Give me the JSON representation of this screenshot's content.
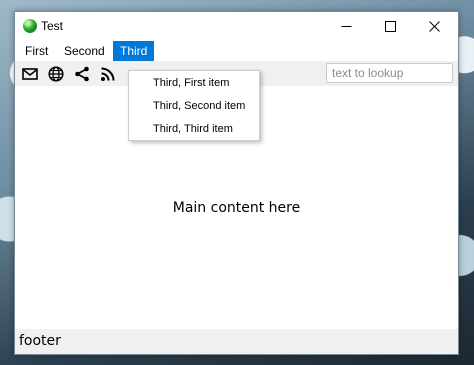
{
  "window": {
    "title": "Test"
  },
  "menubar": {
    "items": [
      {
        "label": "First"
      },
      {
        "label": "Second"
      },
      {
        "label": "Third",
        "state": "open"
      }
    ]
  },
  "dropdown": {
    "items": [
      {
        "label": "Third, First item"
      },
      {
        "label": "Third, Second item"
      },
      {
        "label": "Third, Third item"
      }
    ]
  },
  "toolbar": {
    "icons": [
      "mail-icon",
      "globe-icon",
      "share-icon",
      "rss-icon"
    ],
    "search": {
      "value": "",
      "placeholder": "text to lookup"
    }
  },
  "main": {
    "text": "Main content here"
  },
  "footer": {
    "text": "footer"
  },
  "colors": {
    "menu_highlight": "#0078d7",
    "toolbar_bg": "#f0f0f0",
    "footer_bg": "#f0f0f0"
  }
}
